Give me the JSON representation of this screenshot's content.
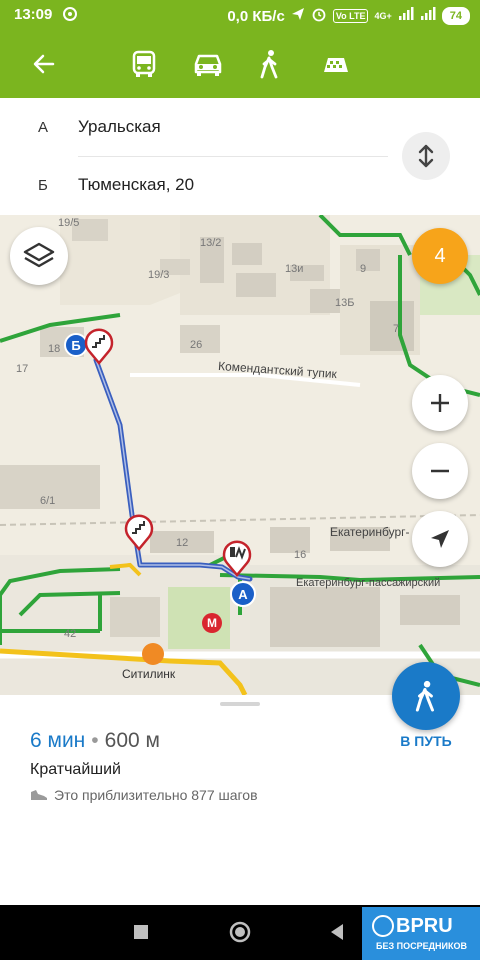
{
  "status_bar": {
    "time": "13:09",
    "speed": "0,0 КБ/с",
    "network_1": "4G+",
    "battery": "74",
    "tag": "Vo LTE"
  },
  "toolbar": {
    "back_icon": "arrow-left-icon",
    "modes": [
      "bus-icon",
      "car-icon",
      "walk-icon",
      "taxi-icon"
    ]
  },
  "route": {
    "from_letter": "А",
    "from": "Уральская",
    "to_letter": "Б",
    "to": "Тюменская, 20"
  },
  "map": {
    "traffic_level": "4",
    "streets": {
      "komendantsky": "Комендантский тупик",
      "ekb1": "Екатеринбург-",
      "ekb2": "Екатеринбург-пассажирский"
    },
    "buildings": [
      "19/5",
      "13/2",
      "19/3",
      "13и",
      "13Б",
      "9",
      "7",
      "26",
      "18",
      "17",
      "6/1",
      "12",
      "16",
      "42"
    ],
    "poi": {
      "citilink": "Ситилинк"
    },
    "markers": {
      "start": "А",
      "end": "Б"
    }
  },
  "sheet": {
    "duration": "6 мин",
    "separator": "•",
    "distance": "600 м",
    "route_type": "Кратчайший",
    "steps_text": "Это приблизительно 877 шагов",
    "go_label": "В ПУТЬ"
  },
  "watermark": {
    "bpru": "BPRU",
    "bpru_sub": "БЕЗ ПОСРЕДНИКОВ"
  },
  "colors": {
    "accent": "#7bb51f",
    "route": "#3a5fbf",
    "primary": "#1a7ac8",
    "traffic": "#f7a41a"
  }
}
